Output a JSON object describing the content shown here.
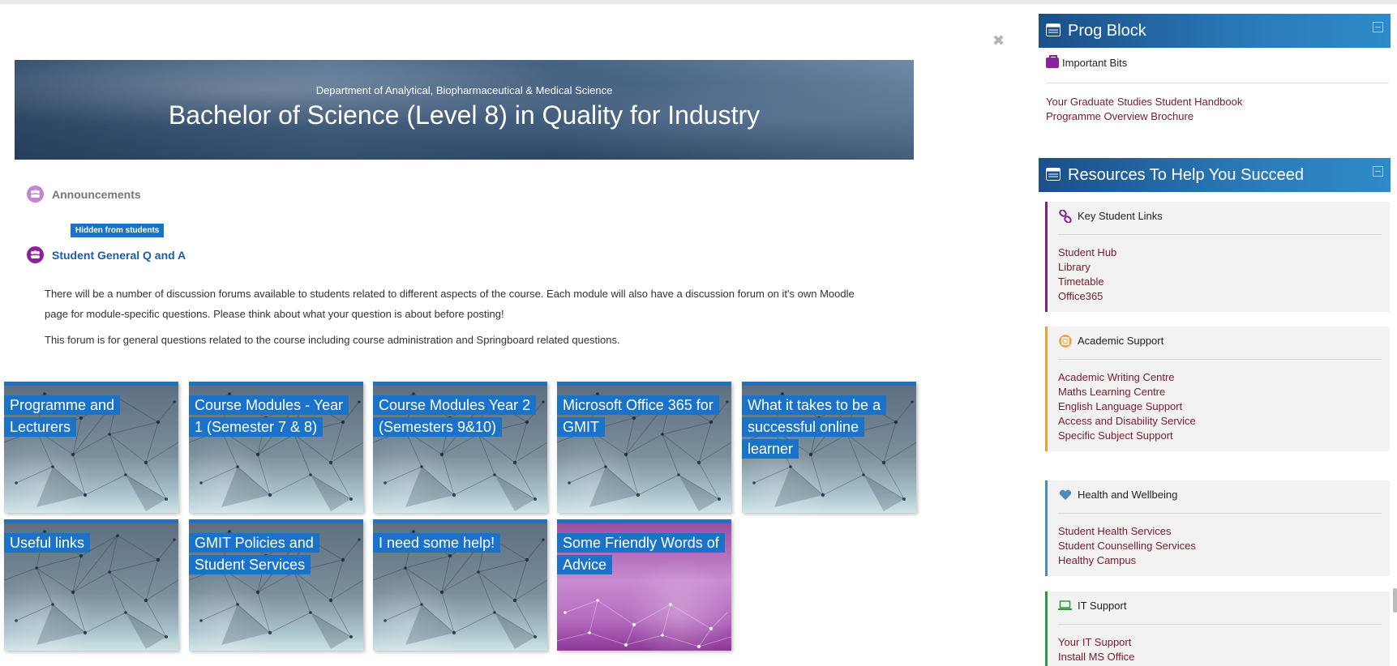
{
  "main": {
    "close_glyph": "✖",
    "banner": {
      "department": "Department of Analytical, Biopharmaceutical & Medical Science",
      "title": "Bachelor of Science (Level 8) in Quality for Industry"
    },
    "announcements": {
      "label": "Announcements"
    },
    "hidden_badge": "Hidden from students",
    "student_forum": {
      "label": "Student General Q and A",
      "description_1": "There will be a number of discussion forums available to students related to different aspects of the course. Each module will also have a discussion forum on it's own Moodle page for module-specific questions. Please think about what your question is about before posting!",
      "description_2": "This forum is for general questions related to the course including course administration and Springboard related questions."
    },
    "tiles": [
      {
        "label": "Programme and Lecturers"
      },
      {
        "label": "Course Modules - Year 1 (Semester 7 & 8)"
      },
      {
        "label": "Course Modules Year 2 (Semesters 9&10)"
      },
      {
        "label": "Microsoft Office 365 for GMIT"
      },
      {
        "label": "What it takes to be a successful online learner"
      },
      {
        "label": "Useful links"
      },
      {
        "label": "GMIT Policies and Student Services"
      },
      {
        "label": "I need some help!"
      },
      {
        "label": "Some Friendly Words of Advice"
      }
    ]
  },
  "sidebar": {
    "prog_block": {
      "title": "Prog Block",
      "subheading": "Important Bits",
      "links": [
        "Your Graduate Studies Student Handbook",
        "Programme Overview Brochure"
      ]
    },
    "resources": {
      "title": "Resources To Help You Succeed",
      "sections": [
        {
          "title": "Key Student Links",
          "accent": "#7b1f8e",
          "links": [
            "Student Hub",
            "Library",
            "Timetable",
            "Office365"
          ]
        },
        {
          "title": "Academic Support",
          "accent": "#f0a030",
          "links": [
            "Academic Writing Centre",
            "Maths Learning Centre",
            "English Language Support",
            "Access and Disability Service",
            "Specific Subject Support"
          ]
        },
        {
          "title": "Health and Wellbeing",
          "accent": "#4a8bc4",
          "links": [
            "Student Health Services",
            "Student Counselling Services",
            "Healthy Campus"
          ]
        },
        {
          "title": "IT Support",
          "accent": "#2f9a3a",
          "links": [
            "Your IT Support",
            "Install MS Office"
          ]
        }
      ]
    }
  },
  "colors": {
    "tile_accent": "#1a73c9",
    "header_blue": "#2a7ab8",
    "link_maroon": "#7a1a2a"
  }
}
